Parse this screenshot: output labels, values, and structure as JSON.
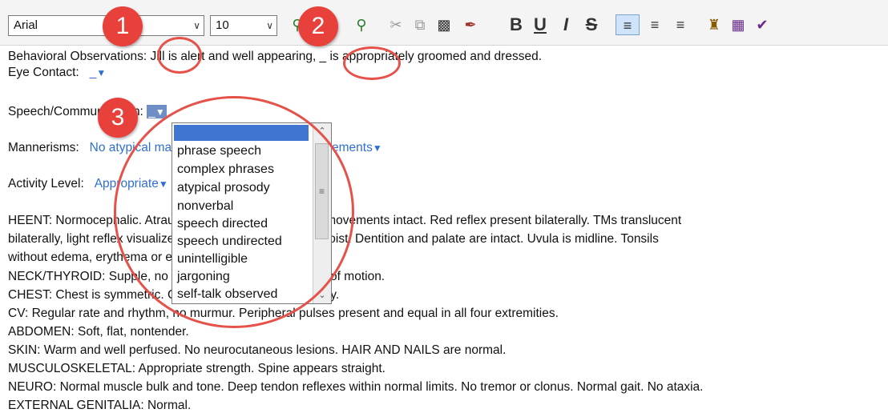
{
  "toolbar": {
    "font_name": "Arial",
    "font_size": "10",
    "icons": [
      "zoom-in-icon",
      "zoom-out-icon",
      "cut-icon",
      "copy-icon",
      "paste-icon",
      "format-painter-icon",
      "bold-icon",
      "underline-icon",
      "italic-icon",
      "strikethrough-icon",
      "align-left-icon",
      "align-center-icon",
      "align-right-icon",
      "stamp-icon",
      "insert-field-icon",
      "spell-check-icon"
    ],
    "bold_label": "B",
    "underline_label": "U",
    "italic_label": "I",
    "strike_label": "S"
  },
  "callouts": [
    "1",
    "2",
    "3"
  ],
  "document": {
    "line1": "Behavioral Observations: Jill is alert and well appearing, _ is appropriately groomed and dressed.",
    "eye_contact_label": "Eye Contact:",
    "eye_contact_value": "_",
    "speech_label": "Speech/Communication:",
    "speech_value": "_",
    "mannerisms_label": "Mannerisms:",
    "mannerisms_value": "No atypical mannerisms or stereotyped movements",
    "activity_label": "Activity Level:",
    "activity_value": "Appropriate",
    "exam_lines": [
      "HEENT: Normocephalic. Atraumatic. PERRL. Extraocular movements intact. Red reflex present bilaterally. TMs translucent",
      "bilaterally, light reflex visualized. Mucus membranes are moist. Dentition and palate are intact. Uvula is midline. Tonsils",
      "without edema, erythema or exudate.",
      "NECK/THYROID: Supple, no lymphadenopathy, full range of motion.",
      "CHEST: Chest is symmetric. Clear to auscultation bilaterally.",
      "CV: Regular rate and rhythm, no murmur. Peripheral pulses present and equal in all four extremities.",
      "ABDOMEN: Soft, flat, nontender.",
      "SKIN: Warm and well perfused. No neurocutaneous lesions. HAIR AND NAILS are normal.",
      "MUSCULOSKELETAL: Appropriate strength. Spine appears straight.",
      "NEURO: Normal muscle bulk and tone. Deep tendon reflexes within normal limits. No tremor or clonus. Normal gait. No ataxia.",
      "EXTERNAL GENITALIA: Normal."
    ]
  },
  "dropdown": {
    "selected": "",
    "options": [
      "phrase speech",
      "complex phrases",
      "atypical prosody",
      "nonverbal",
      "speech directed",
      "speech undirected",
      "unintelligible",
      "jargoning",
      "self-talk observed"
    ]
  },
  "colors": {
    "field": "#2f6fd1",
    "callout": "#e8403a",
    "selection": "#3f76d1"
  }
}
